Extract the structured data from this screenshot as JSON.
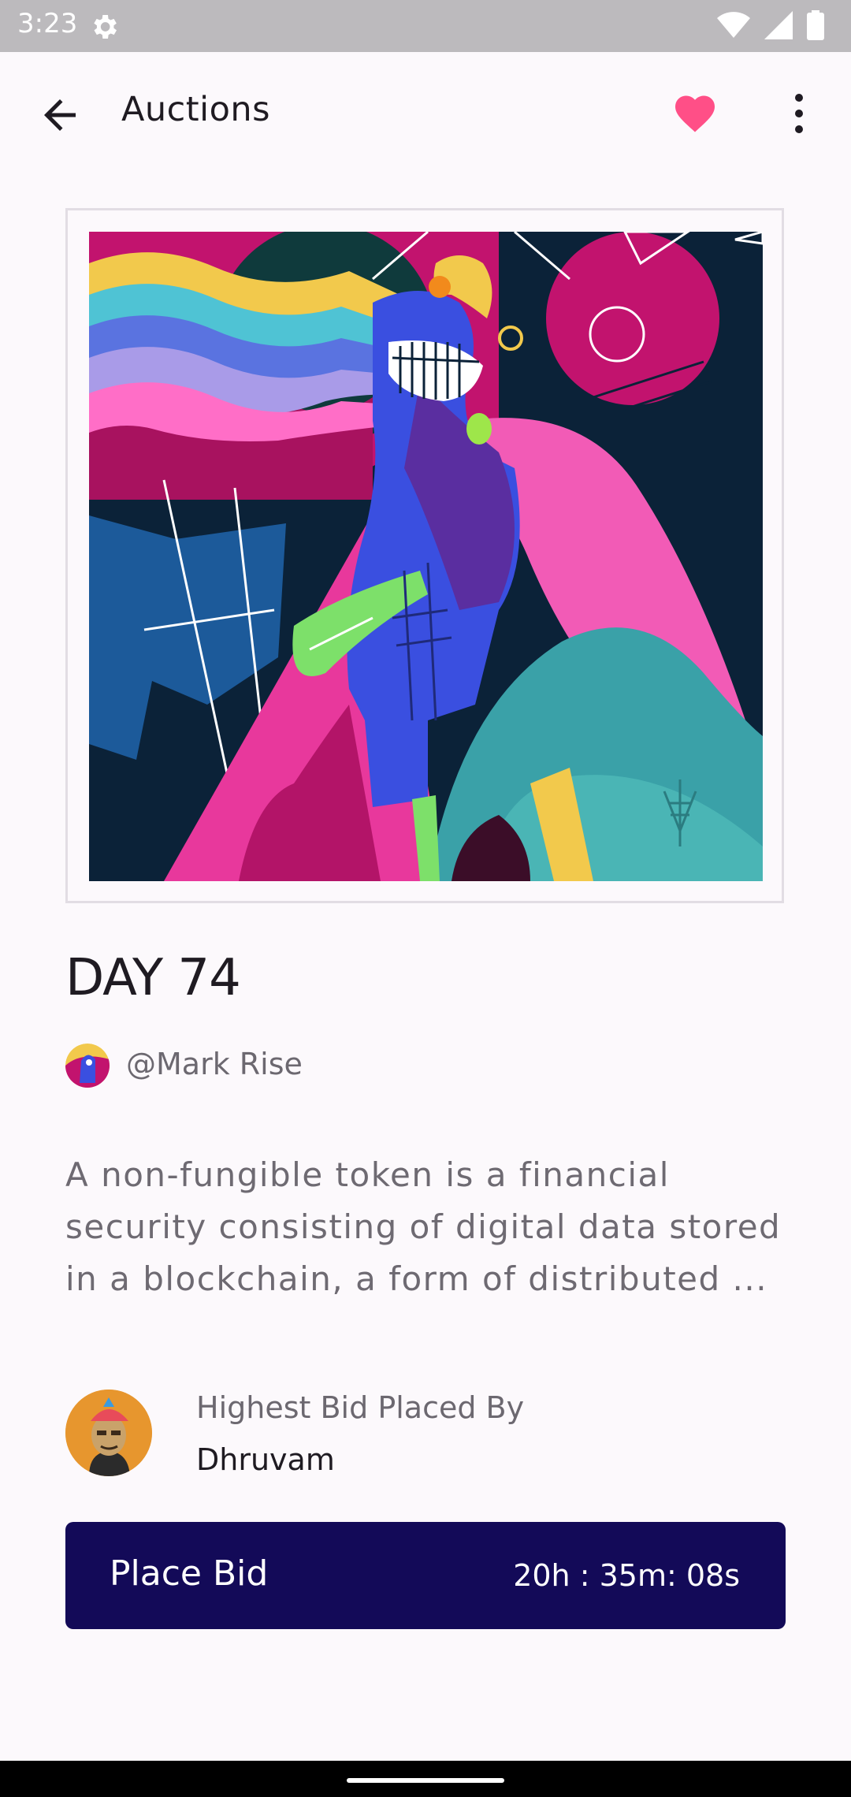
{
  "status_bar": {
    "time": "3:23"
  },
  "app_bar": {
    "title": "Auctions",
    "back_icon": "arrow-back-icon",
    "favorite_icon": "heart-icon",
    "more_icon": "more-vert-icon"
  },
  "nft": {
    "title": "DAY 74",
    "author": "@Mark Rise",
    "description": "A non-fungible token is a financial security consisting of digital data stored in a blockchain, a form of distributed ..."
  },
  "bid": {
    "caption": "Highest Bid Placed By",
    "bidder": "Dhruvam"
  },
  "place_bid": {
    "label": "Place Bid",
    "timer": "20h : 35m: 08s"
  },
  "colors": {
    "accent": "#130a58",
    "favorite": "#ff4f87",
    "background": "#fcf9fc"
  }
}
